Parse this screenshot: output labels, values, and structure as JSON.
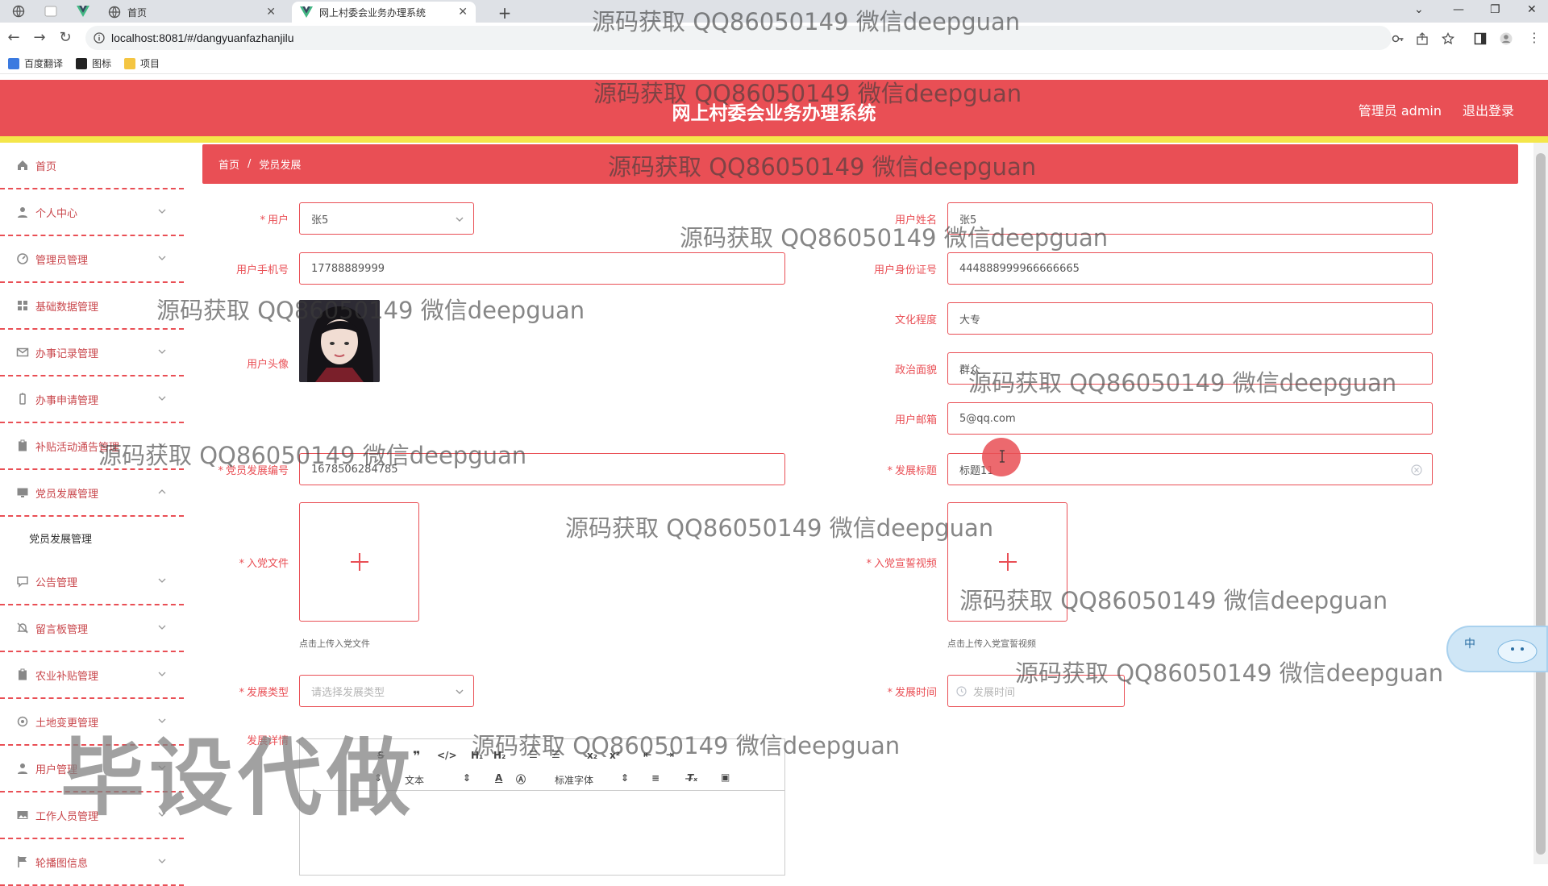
{
  "browser": {
    "tabs": [
      {
        "title": "首页",
        "active": false
      },
      {
        "title": "网上村委会业务办理系统",
        "active": true
      }
    ],
    "url": "localhost:8081/#/dangyuanfazhanjilu",
    "bookmarks": [
      "百度翻译",
      "图标",
      "项目"
    ]
  },
  "header": {
    "title": "网上村委会业务办理系统",
    "user_label": "管理员 admin",
    "logout_label": "退出登录",
    "colors": {
      "primary": "#e94f55",
      "strip": "#f4e64a"
    }
  },
  "sidebar": {
    "items": [
      {
        "label": "首页",
        "icon": "home-icon"
      },
      {
        "label": "个人中心",
        "icon": "user-icon"
      },
      {
        "label": "管理员管理",
        "icon": "gauge-icon"
      },
      {
        "label": "基础数据管理",
        "icon": "grid-icon"
      },
      {
        "label": "办事记录管理",
        "icon": "mail-icon"
      },
      {
        "label": "办事申请管理",
        "icon": "battery-icon"
      },
      {
        "label": "补贴活动通告管理",
        "icon": "clipboard-icon"
      },
      {
        "label": "党员发展管理",
        "icon": "monitor-icon"
      },
      {
        "label": "公告管理",
        "icon": "message-icon"
      },
      {
        "label": "留言板管理",
        "icon": "bell-icon"
      },
      {
        "label": "农业补贴管理",
        "icon": "clipboard-icon"
      },
      {
        "label": "土地变更管理",
        "icon": "settings-icon"
      },
      {
        "label": "用户管理",
        "icon": "user-icon"
      },
      {
        "label": "工作人员管理",
        "icon": "image-icon"
      },
      {
        "label": "轮播图信息",
        "icon": "flag-icon"
      }
    ],
    "submenu": {
      "label": "党员发展管理"
    }
  },
  "breadcrumb": {
    "home": "首页",
    "current": "党员发展"
  },
  "form": {
    "user": {
      "label": "用户",
      "value": "张5"
    },
    "user_name": {
      "label": "用户姓名",
      "value": "张5"
    },
    "phone": {
      "label": "用户手机号",
      "value": "17788889999"
    },
    "id_card": {
      "label": "用户身份证号",
      "value": "444888999966666665"
    },
    "education": {
      "label": "文化程度",
      "value": "大专"
    },
    "avatar": {
      "label": "用户头像"
    },
    "political": {
      "label": "政治面貌",
      "value": "群众"
    },
    "email": {
      "label": "用户邮箱",
      "value": "5@qq.com"
    },
    "dev_number": {
      "label": "党员发展编号",
      "value": "1678506284785"
    },
    "dev_title": {
      "label": "发展标题",
      "value": "标题11"
    },
    "party_file": {
      "label": "入党文件",
      "hint": "点击上传入党文件"
    },
    "oath_video": {
      "label": "入党宣誓视频",
      "hint": "点击上传入党宣誓视频"
    },
    "dev_type": {
      "label": "发展类型",
      "placeholder": "请选择发展类型"
    },
    "dev_time": {
      "label": "发展时间",
      "placeholder": "发展时间"
    },
    "detail": {
      "label": "发展详情"
    }
  },
  "editor": {
    "text_select": "文本",
    "font_select": "标准字体"
  },
  "float_widget": {
    "label": "中"
  },
  "watermark": "源码获取 QQ86050149 微信deepguan",
  "stamp": "毕设代做"
}
